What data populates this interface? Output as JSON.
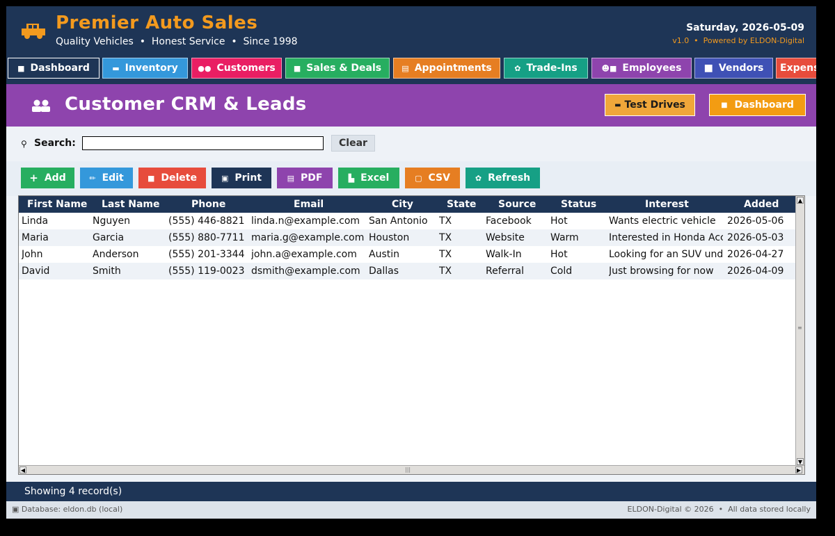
{
  "header": {
    "title": "Premier Auto Sales",
    "subtitle": "Quality Vehicles  •  Honest Service  •  Since 1998",
    "date": "Saturday, 2026-05-09",
    "version": "v1.0  •  Powered by ELDON-Digital"
  },
  "nav": [
    {
      "label": "Dashboard",
      "icon": "home-icon",
      "color": "#1e3556"
    },
    {
      "label": "Inventory",
      "icon": "car-icon",
      "color": "#3498db"
    },
    {
      "label": "Customers",
      "icon": "users-icon",
      "color": "#e91e63"
    },
    {
      "label": "Sales & Deals",
      "icon": "briefcase-icon",
      "color": "#27ae60"
    },
    {
      "label": "Appointments",
      "icon": "calendar-icon",
      "color": "#e67e22"
    },
    {
      "label": "Trade-Ins",
      "icon": "gear-icon",
      "color": "#16a085"
    },
    {
      "label": "Employees",
      "icon": "team-icon",
      "color": "#8e44ad"
    },
    {
      "label": "Vendors",
      "icon": "square-icon",
      "color": "#3f51b5"
    },
    {
      "label": "Expenses",
      "icon": "money-icon",
      "color": "#e74c3c"
    }
  ],
  "banner": {
    "title": "Customer CRM & Leads",
    "test_drives_label": "Test Drives",
    "dashboard_label": "Dashboard"
  },
  "search": {
    "label": "Search:",
    "value": "",
    "clear_label": "Clear"
  },
  "actions": [
    {
      "label": "Add",
      "icon": "plus-icon",
      "color": "#27ae60"
    },
    {
      "label": "Edit",
      "icon": "pencil-icon",
      "color": "#3498db"
    },
    {
      "label": "Delete",
      "icon": "trash-icon",
      "color": "#e74c3c"
    },
    {
      "label": "Print",
      "icon": "printer-icon",
      "color": "#1e3556"
    },
    {
      "label": "PDF",
      "icon": "document-icon",
      "color": "#8e44ad"
    },
    {
      "label": "Excel",
      "icon": "chart-icon",
      "color": "#27ae60"
    },
    {
      "label": "CSV",
      "icon": "file-icon",
      "color": "#e67e22"
    },
    {
      "label": "Refresh",
      "icon": "refresh-icon",
      "color": "#16a085"
    }
  ],
  "table": {
    "columns": [
      "First Name",
      "Last Name",
      "Phone",
      "Email",
      "City",
      "State",
      "Source",
      "Status",
      "Interest",
      "Added"
    ],
    "rows": [
      [
        "Linda",
        "Nguyen",
        "(555) 446-8821",
        "linda.n@example.com",
        "San Antonio",
        "TX",
        "Facebook",
        "Hot",
        "Wants electric vehicle",
        "2026-05-06"
      ],
      [
        "Maria",
        "Garcia",
        "(555) 880-7711",
        "maria.g@example.com",
        "Houston",
        "TX",
        "Website",
        "Warm",
        "Interested in Honda Acco",
        "2026-05-03"
      ],
      [
        "John",
        "Anderson",
        "(555) 201-3344",
        "john.a@example.com",
        "Austin",
        "TX",
        "Walk-In",
        "Hot",
        "Looking for an SUV unde",
        "2026-04-27"
      ],
      [
        "David",
        "Smith",
        "(555) 119-0023",
        "dsmith@example.com",
        "Dallas",
        "TX",
        "Referral",
        "Cold",
        "Just browsing for now",
        "2026-04-09"
      ]
    ]
  },
  "status": {
    "text": "Showing 4 record(s)"
  },
  "footer": {
    "left": "Database: eldon.db (local)",
    "right": "ELDON-Digital © 2026  •  All data stored locally"
  },
  "colors": {
    "header_bg": "#1e3556",
    "accent_orange": "#f39a1e",
    "banner_purple": "#8e44ad"
  }
}
